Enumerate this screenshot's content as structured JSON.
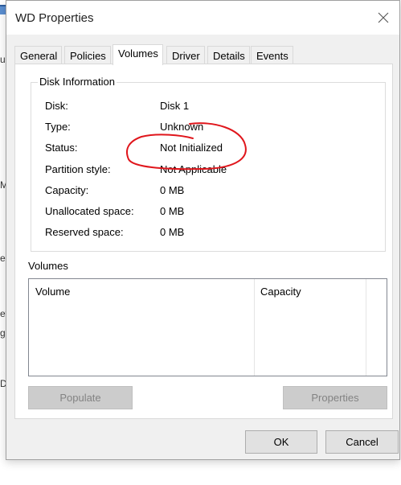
{
  "background": {
    "fragments": [
      "u",
      "M:",
      "es",
      "ev",
      "g",
      "D"
    ]
  },
  "dialog": {
    "title": "WD  Properties",
    "close_icon": "close-icon"
  },
  "tabs": [
    {
      "label": "General"
    },
    {
      "label": "Policies"
    },
    {
      "label": "Volumes",
      "active": true
    },
    {
      "label": "Driver"
    },
    {
      "label": "Details"
    },
    {
      "label": "Events"
    }
  ],
  "disk_info": {
    "group_label": "Disk Information",
    "rows": [
      {
        "label": "Disk:",
        "value": "Disk 1"
      },
      {
        "label": "Type:",
        "value": "Unknown"
      },
      {
        "label": "Status:",
        "value": "Not Initialized"
      },
      {
        "label": "Partition style:",
        "value": "Not Applicable"
      },
      {
        "label": "Capacity:",
        "value": "0 MB"
      },
      {
        "label": "Unallocated space:",
        "value": "0 MB"
      },
      {
        "label": "Reserved space:",
        "value": "0 MB"
      }
    ]
  },
  "volumes": {
    "label": "Volumes",
    "columns": [
      "Volume",
      "Capacity"
    ]
  },
  "buttons": {
    "populate": "Populate",
    "properties": "Properties",
    "ok": "OK",
    "cancel": "Cancel"
  },
  "colors": {
    "annotation": "#e0161c"
  }
}
